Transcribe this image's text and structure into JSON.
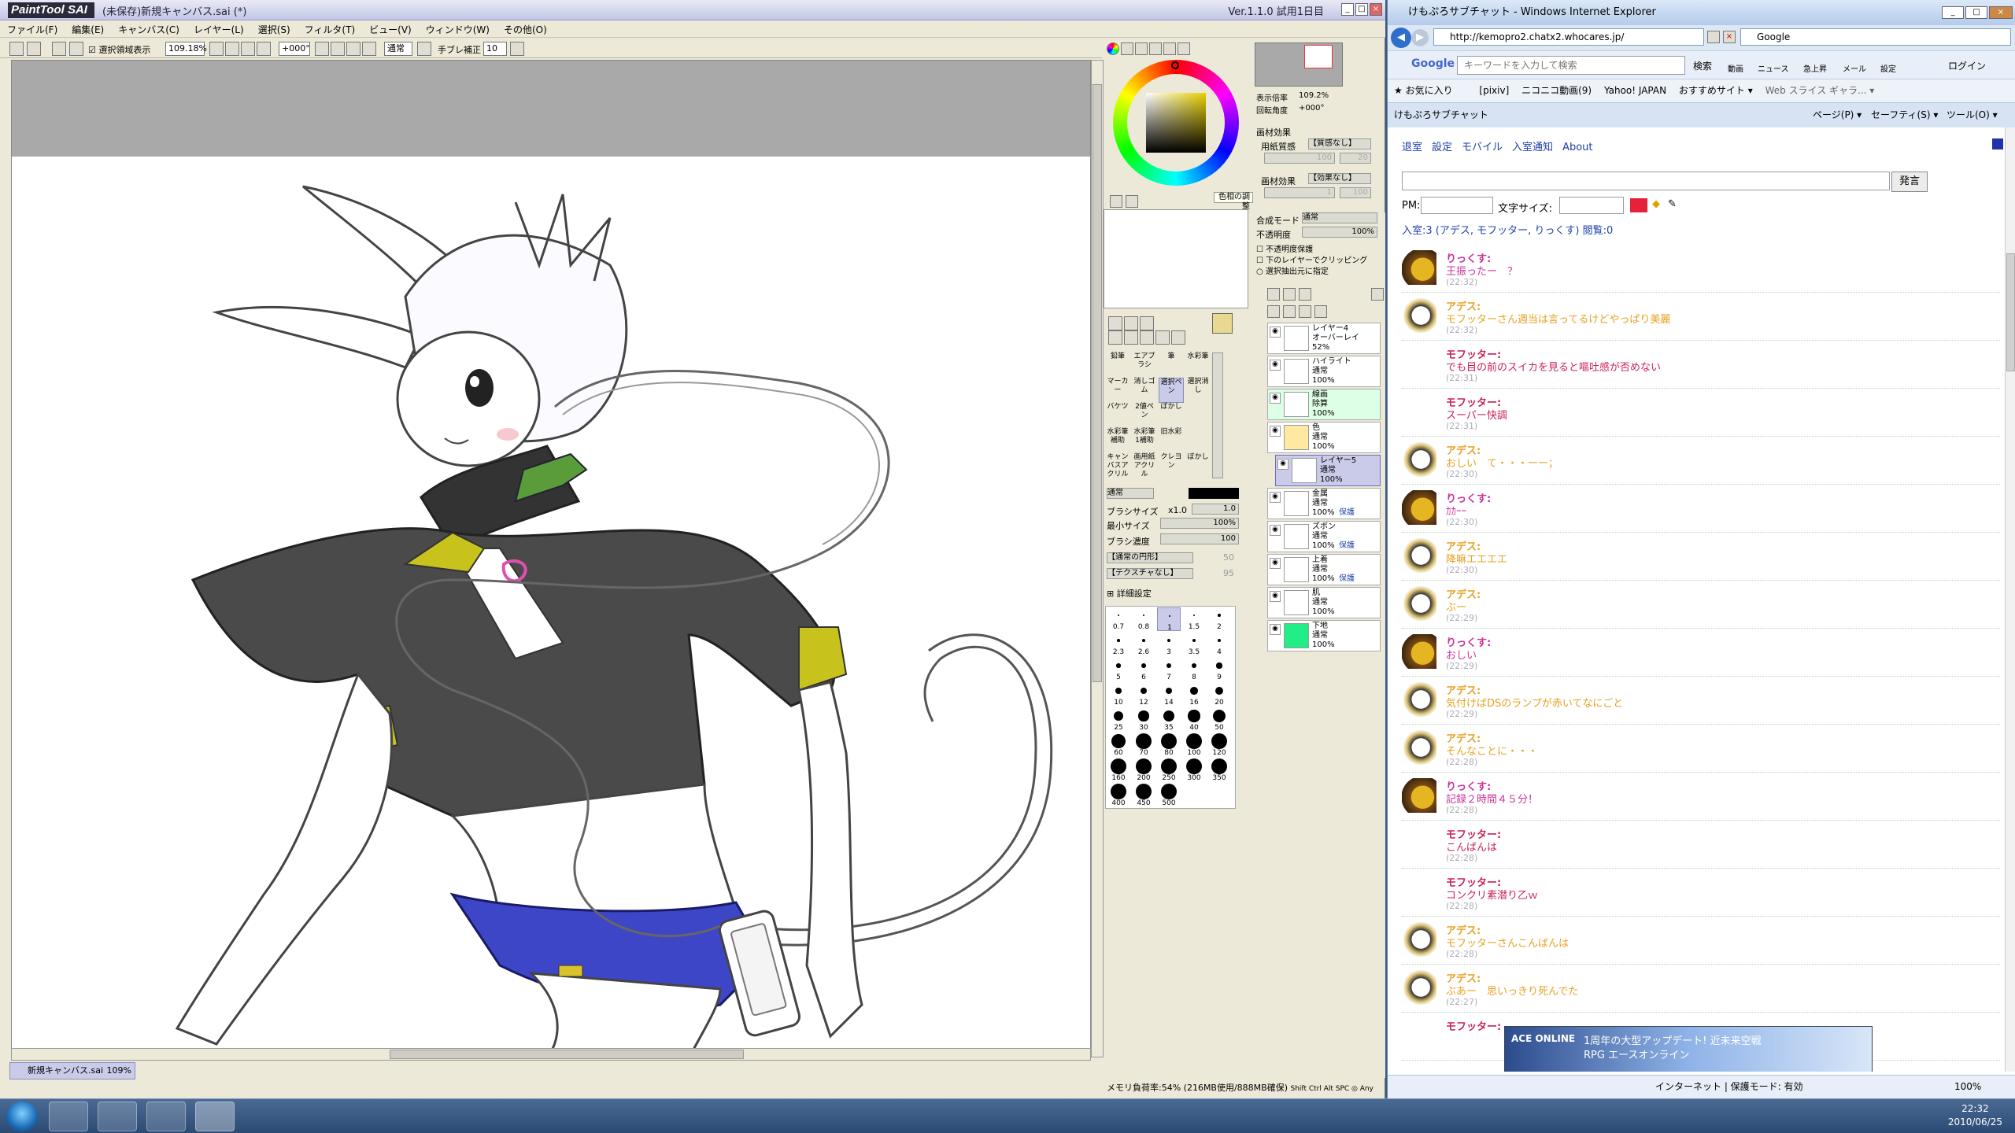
{
  "sai": {
    "logo": "PaintTool SAI",
    "title": "(未保存)新規キャンバス.sai (*)",
    "version": "Ver.1.1.0 試用1日目",
    "menu": [
      "ファイル(F)",
      "編集(E)",
      "キャンバス(C)",
      "レイヤー(L)",
      "選択(S)",
      "フィルタ(T)",
      "ビュー(V)",
      "ウィンドウ(W)",
      "その他(O)"
    ],
    "toolbar": {
      "show_selection": "選択領域表示",
      "zoom": "109.18%",
      "angle": "+000°",
      "mode": "通常",
      "stabilizer_label": "手ブレ補正",
      "stabilizer_value": "10"
    },
    "doc_tab": {
      "name": "新規キャンバス.sai",
      "zoom": "109%"
    },
    "status": "メモリ負荷率:54% (216MB使用/888MB確保)",
    "status_keys": "Shift Ctrl Alt SPC ◎ Any",
    "color_tooltip": "色相の調整",
    "navigator": {
      "zoom_label": "表示倍率",
      "zoom_value": "109.2%",
      "angle_label": "回転角度",
      "angle_value": "+000°"
    },
    "material": {
      "section": "画材効果",
      "paper_label": "用紙質感",
      "paper_value": "【質感なし】",
      "paper_strength": "100",
      "paper_scale": "20",
      "effect_label": "画材効果",
      "effect_value": "【効果なし】",
      "effect_width": "1",
      "effect_strength": "100"
    },
    "layer_props": {
      "blend_label": "合成モード",
      "blend_value": "通常",
      "opacity_label": "不透明度",
      "opacity_value": "100%",
      "preserve_opacity": "不透明度保護",
      "clipping": "下のレイヤーでクリッピング",
      "selection_source": "選択抽出元に指定"
    },
    "layers": [
      {
        "name": "レイヤー4",
        "mode": "オーバーレイ",
        "opacity": "52%",
        "selected": false,
        "folder": false,
        "protect": ""
      },
      {
        "name": "ハイライト",
        "mode": "通常",
        "opacity": "100%",
        "selected": false,
        "folder": false,
        "protect": ""
      },
      {
        "name": "線画",
        "mode": "除算",
        "opacity": "100%",
        "selected": false,
        "folder": false,
        "protect": "",
        "green": true
      },
      {
        "name": "色",
        "mode": "通常",
        "opacity": "100%",
        "selected": false,
        "folder": true,
        "protect": ""
      },
      {
        "name": "レイヤー5",
        "mode": "通常",
        "opacity": "100%",
        "selected": true,
        "folder": false,
        "protect": ""
      },
      {
        "name": "金属",
        "mode": "通常",
        "opacity": "100%",
        "selected": false,
        "folder": false,
        "protect": "保護"
      },
      {
        "name": "ズボン",
        "mode": "通常",
        "opacity": "100%",
        "selected": false,
        "folder": false,
        "protect": "保護"
      },
      {
        "name": "上着",
        "mode": "通常",
        "opacity": "100%",
        "selected": false,
        "folder": false,
        "protect": "保護"
      },
      {
        "name": "肌",
        "mode": "通常",
        "opacity": "100%",
        "selected": false,
        "folder": false,
        "protect": ""
      },
      {
        "name": "下地",
        "mode": "通常",
        "opacity": "100%",
        "selected": false,
        "folder": false,
        "protect": "",
        "fill": "#22ee88"
      }
    ],
    "tools": [
      "鉛筆",
      "エアブラシ",
      "筆",
      "水彩筆",
      "マーカー",
      "消しゴム",
      "選択ペン",
      "選択消し",
      "バケツ",
      "2値ペン",
      "ぼかし",
      "",
      "水彩筆補助",
      "水彩筆1補助",
      "旧水彩",
      "",
      "キャンバスアクリル",
      "画用紙アクリル",
      "クレヨン",
      "ぼかし"
    ],
    "brush": {
      "mode": "通常",
      "size_label": "ブラシサイズ",
      "size_mult": "x1.0",
      "size_value": "1.0",
      "min_label": "最小サイズ",
      "min_value": "100%",
      "density_label": "ブラシ濃度",
      "density_value": "100",
      "shape": "【通常の円形】",
      "texture": "【テクスチャなし】",
      "shape_value": "50",
      "texture_value": "95",
      "detail": "詳細設定"
    },
    "brush_sizes": [
      "0.7",
      "0.8",
      "1",
      "1.5",
      "2",
      "2.3",
      "2.6",
      "3",
      "3.5",
      "4",
      "5",
      "6",
      "7",
      "8",
      "9",
      "10",
      "12",
      "14",
      "16",
      "20",
      "25",
      "30",
      "35",
      "40",
      "50",
      "60",
      "70",
      "80",
      "100",
      "120",
      "160",
      "200",
      "250",
      "300",
      "350",
      "400",
      "450",
      "500"
    ],
    "primary_color": "#e8d890",
    "swatch_color": "#eee8a8"
  },
  "ie": {
    "title": "けもぷろサブチャット - Windows Internet Explorer",
    "url": "http://kemopro2.chatx2.whocares.jp/",
    "search_engine": "Google",
    "google_toolbar": {
      "placeholder": "キーワードを入力して検索",
      "search": "検索",
      "items": [
        "動画",
        "ニュース",
        "急上昇",
        "メール",
        "設定"
      ],
      "login": "ログイン"
    },
    "favorites": {
      "label": "お気に入り",
      "items": [
        "[pixiv]",
        "ニコニコ動画(9)",
        "Yahoo! JAPAN",
        "おすすめサイト ▾",
        "Web スライス ギャラ... ▾"
      ]
    },
    "tab": "けもぷろサブチャット",
    "commands": [
      "ページ(P) ▾",
      "セーフティ(S) ▾",
      "ツール(O) ▾"
    ],
    "page": {
      "nav": [
        "退室",
        "設定",
        "モバイル",
        "入室通知",
        "About"
      ],
      "send_button": "発言",
      "pm_label": "PM:",
      "font_size_label": "文字サイズ:",
      "presence": "入室:3 (アデス, モフッター, りっくす) 閲覧:0",
      "messages": [
        {
          "name": "りっくす:",
          "text": "王振ったー　？",
          "time": "(22:32)",
          "color": "#cc3399",
          "avatar": "rix"
        },
        {
          "name": "アデス:",
          "text": "モフッターさん週当は言ってるけどやっぱり美麗",
          "time": "(22:32)",
          "color": "#e8a020",
          "avatar": "ades"
        },
        {
          "name": "モフッター:",
          "text": "でも目の前のスイカを見ると嘔吐感が否めない",
          "time": "(22:31)",
          "color": "#cc2255",
          "avatar": ""
        },
        {
          "name": "モフッター:",
          "text": "スーパー快調",
          "time": "(22:31)",
          "color": "#cc2255",
          "avatar": ""
        },
        {
          "name": "アデス:",
          "text": "おしい　て・・・ーー；",
          "time": "(22:30)",
          "color": "#e8a020",
          "avatar": "ades"
        },
        {
          "name": "りっくす:",
          "text": "ｶｶｰｰ",
          "time": "(22:30)",
          "color": "#cc3399",
          "avatar": "rix"
        },
        {
          "name": "アデス:",
          "text": "降嘛エエエエ",
          "time": "(22:30)",
          "color": "#e8a020",
          "avatar": "ades"
        },
        {
          "name": "アデス:",
          "text": "ぶー",
          "time": "(22:29)",
          "color": "#e8a020",
          "avatar": "ades"
        },
        {
          "name": "りっくす:",
          "text": "おしい",
          "time": "(22:29)",
          "color": "#cc3399",
          "avatar": "rix"
        },
        {
          "name": "アデス:",
          "text": "気付けばDSのランプが赤いてなにごと",
          "time": "(22:29)",
          "color": "#e8a020",
          "avatar": "ades"
        },
        {
          "name": "アデス:",
          "text": "そんなことに・・・",
          "time": "(22:28)",
          "color": "#e8a020",
          "avatar": "ades"
        },
        {
          "name": "りっくす:",
          "text": "記録２時間４５分！",
          "time": "(22:28)",
          "color": "#cc3399",
          "avatar": "rix"
        },
        {
          "name": "モフッター:",
          "text": "こんばんは",
          "time": "(22:28)",
          "color": "#cc2255",
          "avatar": ""
        },
        {
          "name": "モフッター:",
          "text": "コンクリ素潜り乙ｗ",
          "time": "(22:28)",
          "color": "#cc2255",
          "avatar": ""
        },
        {
          "name": "アデス:",
          "text": "モフッターさんこんばんは",
          "time": "(22:28)",
          "color": "#e8a020",
          "avatar": "ades"
        },
        {
          "name": "アデス:",
          "text": "ぶあー　思いっきり死んでた",
          "time": "(22:27)",
          "color": "#e8a020",
          "avatar": "ades"
        },
        {
          "name": "モフッター:",
          "text": "",
          "time": "",
          "color": "#cc2255",
          "avatar": ""
        }
      ],
      "banner": {
        "logo": "ACE ONLINE",
        "text": "1周年の大型アップデート! 近未来空戦RPG エースオンライン"
      }
    },
    "status": {
      "zone": "インターネット | 保護モード: 有効",
      "zoom": "100%"
    }
  },
  "taskbar": {
    "time": "22:32",
    "date": "2010/06/25"
  }
}
